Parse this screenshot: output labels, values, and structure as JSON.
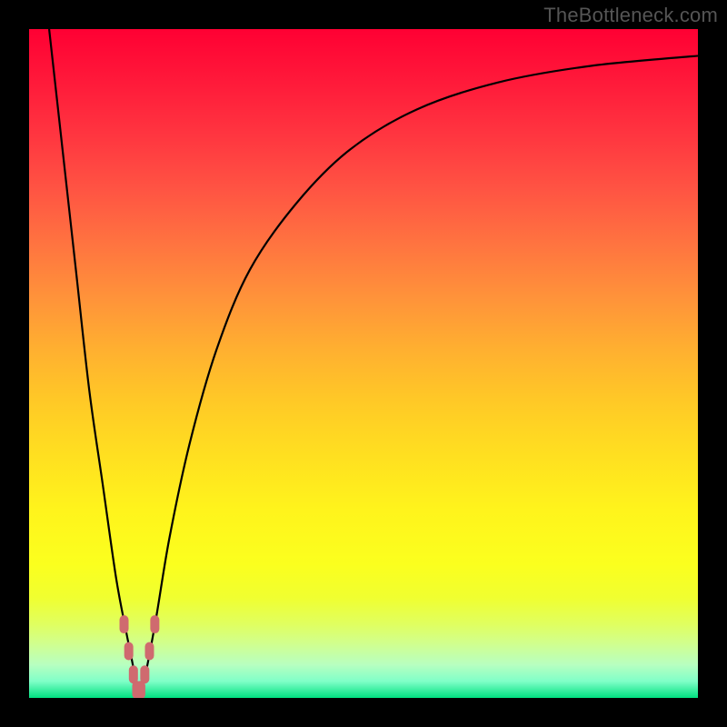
{
  "watermark": "TheBottleneck.com",
  "colors": {
    "frame": "#000000",
    "curve": "#000000",
    "marker_fill": "#cf6a6f",
    "marker_stroke": "#cf6a6f",
    "gradient_top": "#ff0033",
    "gradient_bottom": "#00e080"
  },
  "chart_data": {
    "type": "line",
    "title": "",
    "xlabel": "",
    "ylabel": "",
    "xlim": [
      0,
      100
    ],
    "ylim": [
      0,
      100
    ],
    "series": [
      {
        "name": "left-branch",
        "x": [
          3,
          5,
          7,
          9,
          11,
          13,
          14.5,
          15.5,
          16,
          16.5
        ],
        "y": [
          100,
          82,
          64,
          46,
          32,
          18,
          10,
          5,
          2,
          0
        ]
      },
      {
        "name": "right-branch",
        "x": [
          16.5,
          17.5,
          19,
          21,
          24,
          28,
          33,
          40,
          48,
          58,
          70,
          84,
          100
        ],
        "y": [
          0,
          4,
          12,
          24,
          38,
          52,
          64,
          74,
          82,
          88,
          92,
          94.5,
          96
        ]
      }
    ],
    "markers": {
      "name": "bottom-cluster",
      "x": [
        14.2,
        14.9,
        15.6,
        16.1,
        16.7,
        17.3,
        18.0,
        18.8
      ],
      "y": [
        11,
        7,
        3.5,
        1.2,
        1.2,
        3.5,
        7,
        11
      ]
    }
  }
}
